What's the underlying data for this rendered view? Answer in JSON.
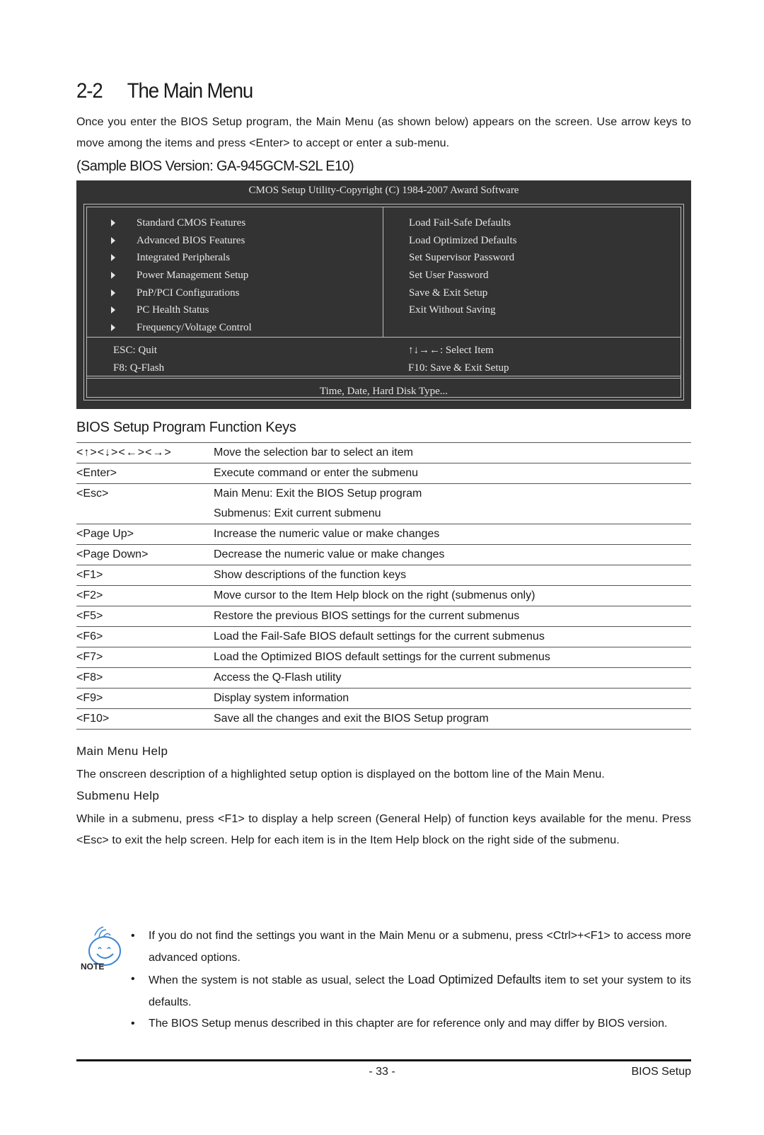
{
  "section": {
    "number": "2-2",
    "title": "The Main Menu"
  },
  "intro": "Once you enter the BIOS Setup program, the Main Menu (as shown below) appears on the screen. Use arrow keys to move among the items and press <Enter> to accept or enter a sub-menu.",
  "sample_caption": "(Sample BIOS Version: GA-945GCM-S2L E10)",
  "bios_screen": {
    "header": "CMOS Setup Utility-Copyright (C) 1984-2007 Award Software",
    "left_menu": [
      "Standard CMOS Features",
      "Advanced BIOS Features",
      "Integrated Peripherals",
      "Power Management Setup",
      "PnP/PCI Configurations",
      "PC Health Status",
      "Frequency/Voltage Control"
    ],
    "right_menu": [
      "Load Fail-Safe Defaults",
      "Load Optimized Defaults",
      "Set Supervisor Password",
      "Set User Password",
      "Save & Exit Setup",
      "Exit Without Saving"
    ],
    "keys": {
      "esc": "ESC: Quit",
      "select": "↑↓→←: Select Item",
      "f8": "F8: Q-Flash",
      "f10": "F10: Save & Exit Setup"
    },
    "status_line": "Time, Date, Hard Disk Type..."
  },
  "function_keys": {
    "heading": "BIOS Setup Program Function Keys",
    "rows": [
      {
        "key": "<↑><↓><←><→>",
        "desc": [
          "Move the selection bar to select an item"
        ]
      },
      {
        "key": "<Enter>",
        "desc": [
          "Execute command or enter the submenu"
        ]
      },
      {
        "key": "<Esc>",
        "desc": [
          "Main Menu: Exit the BIOS Setup program",
          "Submenus: Exit current submenu"
        ]
      },
      {
        "key": "<Page Up>",
        "desc": [
          "Increase the numeric value or make changes"
        ]
      },
      {
        "key": "<Page Down>",
        "desc": [
          "Decrease the numeric value or make changes"
        ]
      },
      {
        "key": "<F1>",
        "desc": [
          "Show descriptions of the function keys"
        ]
      },
      {
        "key": "<F2>",
        "desc": [
          "Move cursor to the Item Help block on the right (submenus only)"
        ]
      },
      {
        "key": "<F5>",
        "desc": [
          "Restore the previous BIOS settings for the current submenus"
        ]
      },
      {
        "key": "<F6>",
        "desc": [
          "Load the Fail-Safe BIOS default settings for the current submenus"
        ]
      },
      {
        "key": "<F7>",
        "desc": [
          "Load the Optimized BIOS default settings for the current submenus"
        ]
      },
      {
        "key": "<F8>",
        "desc": [
          "Access the Q-Flash utility"
        ]
      },
      {
        "key": "<F9>",
        "desc": [
          "Display system information"
        ]
      },
      {
        "key": "<F10>",
        "desc": [
          "Save all the changes and exit the BIOS Setup program"
        ]
      }
    ]
  },
  "main_menu_help": {
    "heading": "Main Menu Help",
    "text": "The onscreen description of a highlighted setup option is displayed on the bottom line of the Main Menu."
  },
  "submenu_help": {
    "heading": "Submenu Help",
    "text": "While in a submenu, press <F1> to display a help screen (General Help) of function keys available for the menu. Press <Esc> to exit the help screen. Help for each item is in the Item Help block on the right side of the submenu."
  },
  "note": {
    "icon_label": "NOTE",
    "bullet": "•",
    "items": [
      {
        "text": "If you do not find the settings you want in the Main Menu or a submenu, press <Ctrl>+<F1> to access more advanced options."
      },
      {
        "before": "When the system is not stable as usual, select the ",
        "highlight": "Load Optimized Defaults",
        "after": " item to set your system to its defaults."
      },
      {
        "text": "The BIOS Setup menus described in this chapter are for reference only and may differ by BIOS version."
      }
    ]
  },
  "footer": {
    "page_number": "- 33 -",
    "section_label": "BIOS Setup"
  },
  "colors": {
    "bios_bg": "#333333",
    "bios_text": "#e6e6e6",
    "note_icon": "#3a86d4"
  }
}
